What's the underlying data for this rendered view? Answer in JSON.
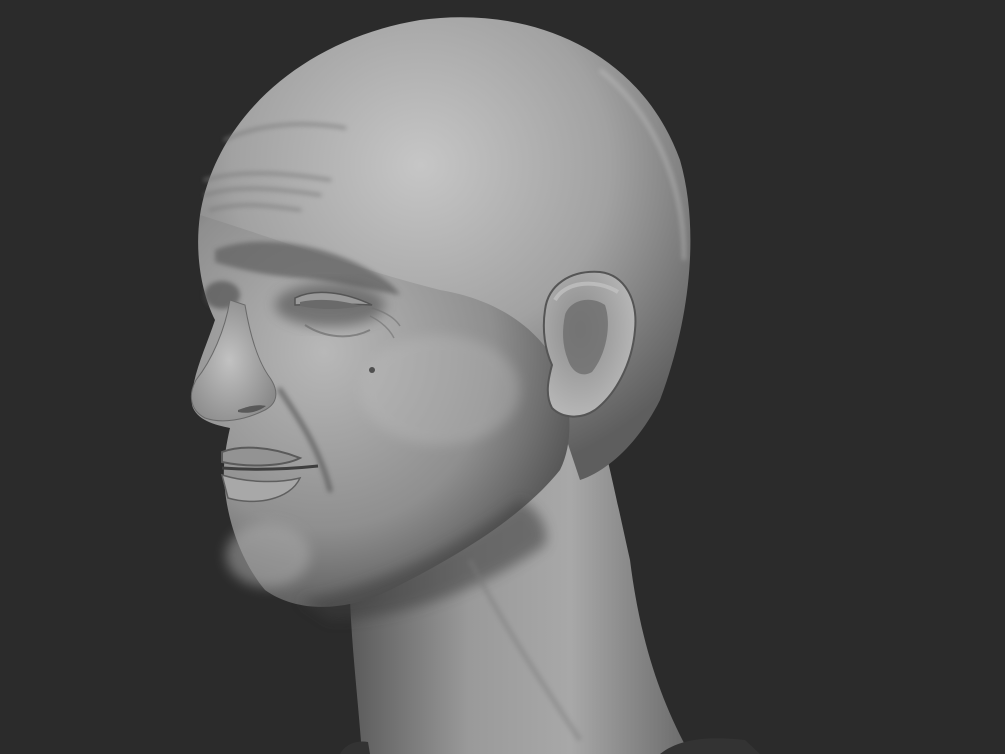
{
  "scene": {
    "background_color": "#2b2b2b",
    "material": "grey-clay",
    "subject": "bald-male-head-sculpt",
    "colors": {
      "clay_highlight": "#c4c4c4",
      "clay_mid": "#8e8e8e",
      "clay_shadow": "#3c3c3c",
      "shirt": "#333333"
    }
  }
}
